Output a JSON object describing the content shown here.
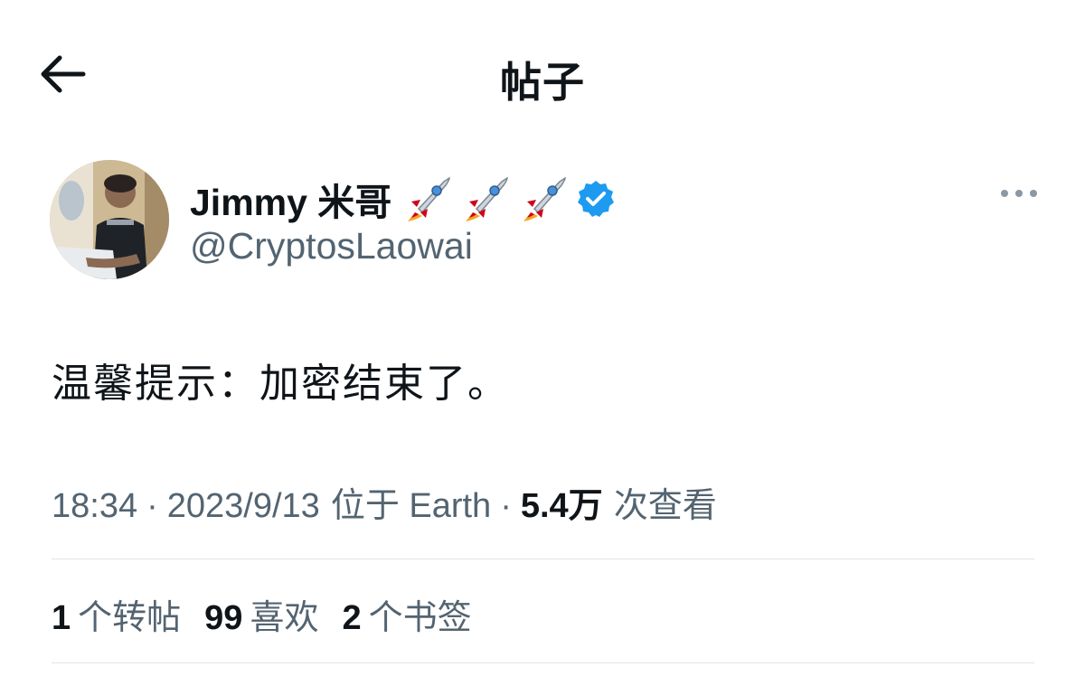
{
  "header": {
    "title": "帖子",
    "back_icon": "arrow-left-icon"
  },
  "author": {
    "display_name": "Jimmy 米哥",
    "emoji": [
      "rocket",
      "rocket",
      "rocket"
    ],
    "verified": true,
    "verified_color": "#1d9bf0",
    "handle": "@CryptosLaowai",
    "more_icon": "more-horizontal-icon"
  },
  "tweet": {
    "text": "温馨提示：加密结束了。"
  },
  "meta": {
    "time": "18:34",
    "separator": "·",
    "date": "2023/9/13",
    "location": "位于 Earth",
    "views_count": "5.4万",
    "views_label": "次查看"
  },
  "stats": [
    {
      "count": "1",
      "label": "个转帖"
    },
    {
      "count": "99",
      "label": "喜欢"
    },
    {
      "count": "2",
      "label": "个书签"
    }
  ],
  "colors": {
    "text_primary": "#0f1419",
    "text_secondary": "#536471",
    "divider": "#dfe3e7",
    "verified": "#1d9bf0"
  }
}
